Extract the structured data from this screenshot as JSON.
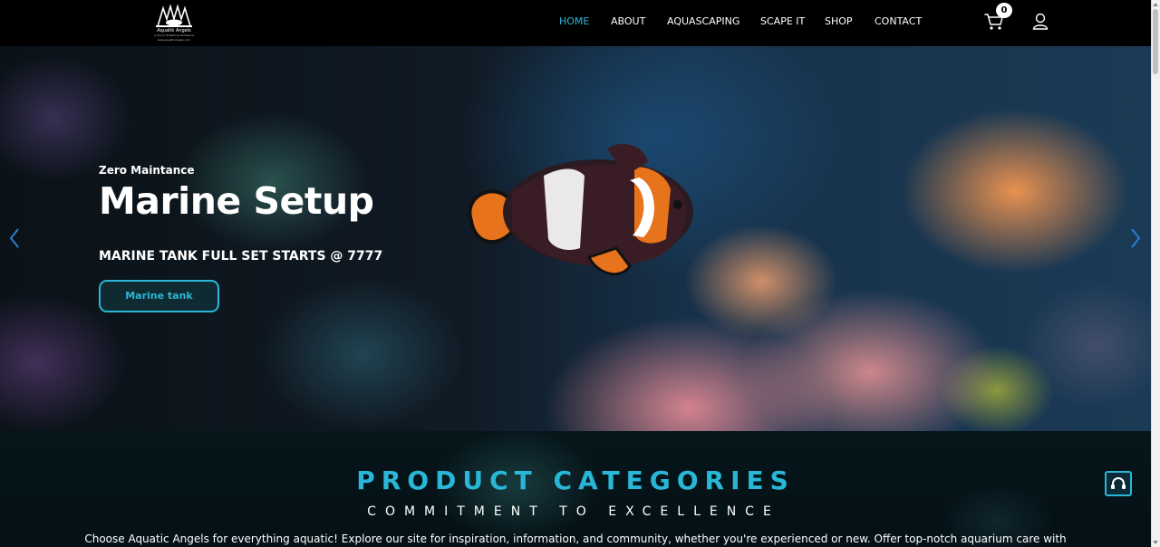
{
  "brand": {
    "name": "Aquatik Angels",
    "tagline": "A Touch Of Natural Ambiance",
    "url": "www.aquaticangels.com"
  },
  "nav": {
    "items": [
      "HOME",
      "ABOUT",
      "AQUASCAPING",
      "SCAPE IT",
      "SHOP",
      "CONTACT"
    ],
    "active": "HOME",
    "cart_count": "0",
    "icons": {
      "cart": "cart-icon",
      "user": "user-icon"
    }
  },
  "hero": {
    "eyebrow": "Zero Maintance",
    "title": "Marine Setup",
    "offer": "MARINE TANK FULL SET STARTS @ 7777",
    "button_label": "Marine tank",
    "icons": {
      "prev": "chevron-left-icon",
      "next": "chevron-right-icon"
    }
  },
  "categories": {
    "title": "PRODUCT CATEGORIES",
    "subtitle": "COMMITMENT TO EXCELLENCE",
    "body": "Choose Aquatic Angels for everything aquatic! Explore our site for inspiration, information, and community, whether you're experienced or new. Offer top-notch aquarium care with"
  },
  "support": {
    "icon": "headset-icon"
  },
  "colors": {
    "accent": "#29b7d8",
    "nav_bg": "#000000",
    "section_bg": "#06161b",
    "text": "#ffffff"
  }
}
